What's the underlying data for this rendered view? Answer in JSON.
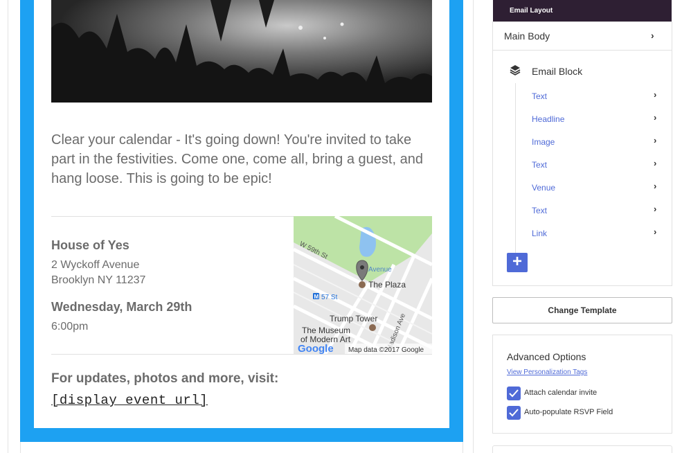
{
  "email": {
    "body_text": "Clear your calendar - It's going down! You're invited to take part in the festivities. Come one, come all, bring a guest, and hang loose. This is going to be epic!",
    "venue": {
      "name": "House of Yes",
      "address_line1": "2 Wyckoff Avenue",
      "address_line2": "Brooklyn NY 11237",
      "date": "Wednesday, March 29th",
      "time": "6:00pm"
    },
    "map": {
      "labels": {
        "street_w59": "W 59th St",
        "avenue": "Avenue",
        "plaza": "The Plaza",
        "subway": "57 St",
        "trump_tower": "Trump Tower",
        "museum_line1": "The Museum",
        "museum_line2": "of Modern Art",
        "madison_ave": "Madison Ave",
        "map_data": "Map data ©2017 Google",
        "google_logo": "Google"
      }
    },
    "updates_text": "For updates, photos and more, visit:",
    "event_url": "[display_event_url]"
  },
  "sidebar": {
    "header": "Email Layout",
    "main_body": "Main Body",
    "email_block": "Email Block",
    "items": [
      {
        "label": "Text"
      },
      {
        "label": "Headline"
      },
      {
        "label": "Image"
      },
      {
        "label": "Text"
      },
      {
        "label": "Venue"
      },
      {
        "label": "Text"
      },
      {
        "label": "Link"
      }
    ],
    "add_label": "+",
    "change_template": "Change Template",
    "advanced": {
      "title": "Advanced Options",
      "link": "View Personalization Tags",
      "options": [
        {
          "label": "Attach calendar invite",
          "checked": true
        },
        {
          "label": "Auto-populate RSVP Field",
          "checked": true
        }
      ]
    }
  },
  "colors": {
    "email_border": "#1da1f2",
    "accent": "#4f6ad7",
    "header_bg": "#2e1f33"
  }
}
